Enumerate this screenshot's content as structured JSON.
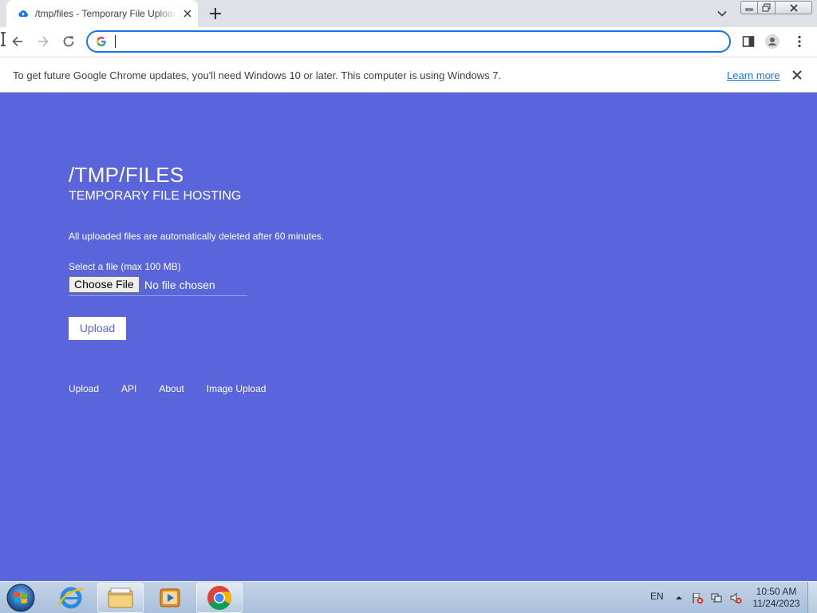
{
  "browser": {
    "tab": {
      "title": "/tmp/files - Temporary File Upload",
      "favicon": "cloud-upload-icon"
    },
    "address": {
      "value": "",
      "placeholder": ""
    },
    "infobar": {
      "message": "To get future Google Chrome updates, you'll need Windows 10 or later. This computer is using Windows 7.",
      "link": "Learn more"
    }
  },
  "page": {
    "title": "/TMP/FILES",
    "subtitle": "TEMPORARY FILE HOSTING",
    "notice": "All uploaded files are automatically deleted after 60 minutes.",
    "file_label": "Select a file (max 100 MB)",
    "choose_button": "Choose File",
    "no_file_text": "No file chosen",
    "upload_button": "Upload",
    "footer_links": [
      "Upload",
      "API",
      "About",
      "Image Upload"
    ]
  },
  "taskbar": {
    "language": "EN",
    "time": "10:50 AM",
    "date": "11/24/2023"
  },
  "colors": {
    "page_background": "#5a64db",
    "accent_blue": "#1a73e8"
  }
}
